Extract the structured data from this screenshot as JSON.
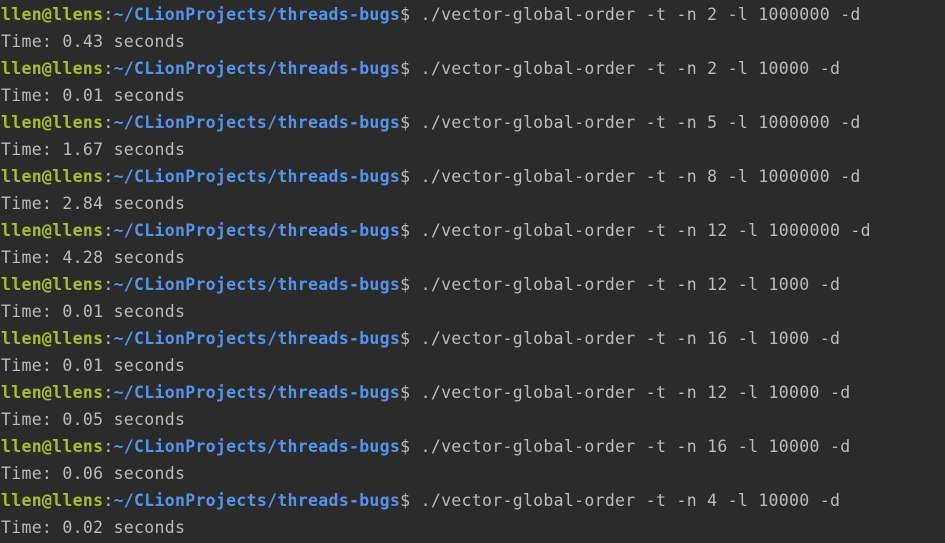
{
  "terminal": {
    "user_host": "llen@llens",
    "separator": ":",
    "path": "~/CLionProjects/threads-bugs",
    "prompt_symbol": "$",
    "colors": {
      "background": "#2b2b2b",
      "user_host": "#a8c023",
      "path": "#5394ec",
      "text": "#bbbbbb"
    },
    "entries": [
      {
        "command": "./vector-global-order -t -n 2 -l 1000000 -d",
        "output": "Time: 0.43 seconds"
      },
      {
        "command": "./vector-global-order -t -n 2 -l 10000 -d",
        "output": "Time: 0.01 seconds"
      },
      {
        "command": "./vector-global-order -t -n 5 -l 1000000 -d",
        "output": "Time: 1.67 seconds"
      },
      {
        "command": "./vector-global-order -t -n 8 -l 1000000 -d",
        "output": "Time: 2.84 seconds"
      },
      {
        "command": "./vector-global-order -t -n 12 -l 1000000 -d",
        "output": "Time: 4.28 seconds"
      },
      {
        "command": "./vector-global-order -t -n 12 -l 1000 -d",
        "output": "Time: 0.01 seconds"
      },
      {
        "command": "./vector-global-order -t -n 16 -l 1000 -d",
        "output": "Time: 0.01 seconds"
      },
      {
        "command": "./vector-global-order -t -n 12 -l 10000 -d",
        "output": "Time: 0.05 seconds"
      },
      {
        "command": "./vector-global-order -t -n 16 -l 10000 -d",
        "output": "Time: 0.06 seconds"
      },
      {
        "command": "./vector-global-order -t -n 4 -l 10000 -d",
        "output": "Time: 0.02 seconds"
      }
    ]
  }
}
